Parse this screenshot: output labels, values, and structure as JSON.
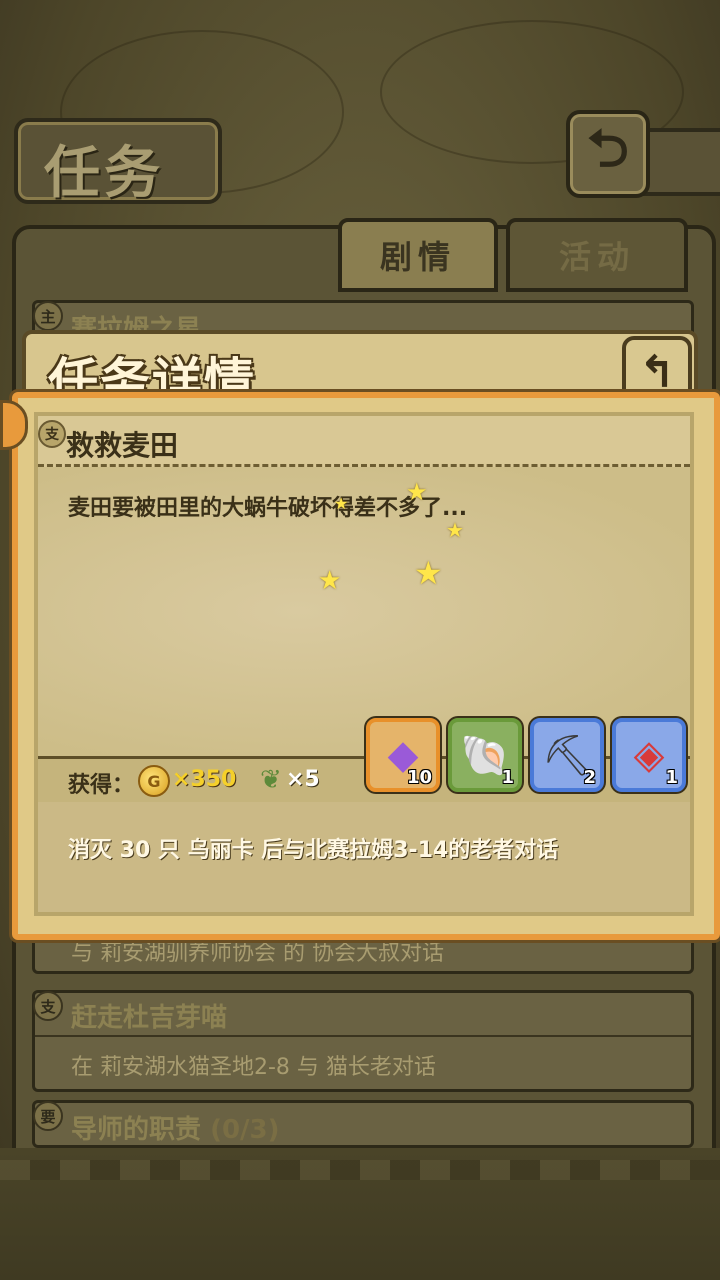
{
  "header": {
    "title": "任务"
  },
  "tabs": [
    {
      "label": "剧情"
    },
    {
      "label": "活动"
    }
  ],
  "list": {
    "items": [
      {
        "badge": "主",
        "title": "赛拉姆之星"
      },
      {
        "desc": "与 莉安湖驯养师协会 的 协会大叔对话"
      },
      {
        "badge": "支",
        "title": "赶走杜吉芽喵",
        "desc": "在 莉安湖水猫圣地2-8 与 猫长老对话"
      },
      {
        "badge": "要",
        "title": "导师的职责",
        "progress": "(0/3)"
      }
    ]
  },
  "modal": {
    "title": "任务详情",
    "quest": {
      "badge": "支",
      "name": "救救麦田",
      "description": "麦田要被田里的大蜗牛破坏得差不多了...",
      "objective": "消灭 30 只 乌丽卡 后与北赛拉姆3-14的老者对话"
    },
    "rewards": {
      "label": "获得：",
      "coin_symbol": "G",
      "coin_amount": "×350",
      "feather_amount": "×5",
      "items": [
        {
          "icon": "purple-crystal-icon",
          "count": "10",
          "border": "#e8902a"
        },
        {
          "icon": "shell-icon",
          "count": "1",
          "border": "#6a9a3a"
        },
        {
          "icon": "pickaxe-icon",
          "count": "2",
          "border": "#4a7ad8"
        },
        {
          "icon": "red-ore-icon",
          "count": "1",
          "border": "#4a7ad8"
        }
      ]
    }
  },
  "colors": {
    "accent_orange": "#e89a3c",
    "coin_text": "#f5d02a"
  }
}
